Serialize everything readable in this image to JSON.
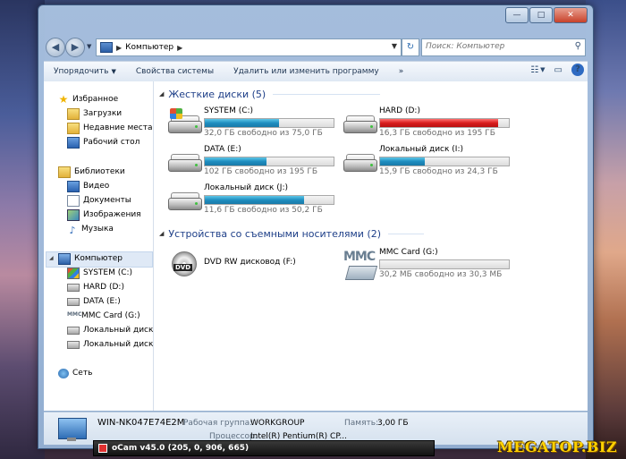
{
  "address": {
    "breadcrumb": "Компьютер",
    "search_placeholder": "Поиск: Компьютер"
  },
  "window_controls": {
    "minimize": "—",
    "maximize": "□",
    "close": "✕"
  },
  "toolbar": {
    "organize": "Упорядочить",
    "system_props": "Свойства системы",
    "uninstall": "Удалить или изменить программу",
    "more": "»",
    "help": "?"
  },
  "nav": {
    "favorites": "Избранное",
    "downloads": "Загрузки",
    "recent": "Недавние места",
    "desktop": "Рабочий стол",
    "libraries": "Библиотеки",
    "video": "Видео",
    "documents": "Документы",
    "images": "Изображения",
    "music": "Музыка",
    "computer": "Компьютер",
    "drive_c": "SYSTEM (C:)",
    "drive_d": "HARD (D:)",
    "drive_e": "DATA (E:)",
    "drive_g": "MMC Card (G:)",
    "drive_i": "Локальный диск (I:)",
    "drive_j": "Локальный диск (J:)",
    "network": "Сеть"
  },
  "groups": {
    "hdd": "Жесткие диски (5)",
    "removable": "Устройства со съемными носителями (2)"
  },
  "drives": [
    {
      "name": "SYSTEM (C:)",
      "free": "32,0 ГБ свободно из 75,0 ГБ",
      "used_fraction": 0.573,
      "status": "normal"
    },
    {
      "name": "HARD (D:)",
      "free": "16,3 ГБ свободно из 195 ГБ",
      "used_fraction": 0.916,
      "status": "full"
    },
    {
      "name": "DATA (E:)",
      "free": "102 ГБ свободно из 195 ГБ",
      "used_fraction": 0.477,
      "status": "normal"
    },
    {
      "name": "Локальный диск (I:)",
      "free": "15,9 ГБ свободно из 24,3 ГБ",
      "used_fraction": 0.346,
      "status": "normal"
    },
    {
      "name": "Локальный диск (J:)",
      "free": "11,6 ГБ свободно из 50,2 ГБ",
      "used_fraction": 0.769,
      "status": "normal"
    }
  ],
  "removable": {
    "dvd": {
      "name": "DVD RW дисковод (F:)",
      "icon_label": "DVD"
    },
    "mmc": {
      "name": "MMC Card (G:)",
      "free": "30,2 МБ свободно из 30,3 МБ",
      "used_fraction": 0.003,
      "logo": "MMC"
    }
  },
  "details": {
    "pc_name": "WIN-NK047E74E2M",
    "workgroup_label": "Рабочая группа:",
    "workgroup": "WORKGROUP",
    "memory_label": "Память:",
    "memory": "3,00 ГБ",
    "cpu_label": "Процессор:",
    "cpu": "Intel(R) Pentium(R) CP..."
  },
  "ocam": {
    "title": "oCam v45.0 (205, 0, 906, 665)"
  },
  "watermark": "MEGATOP.BIZ",
  "colors": {
    "bar_normal": "#1e8dbf",
    "bar_full": "#d81c1c",
    "group_header": "#1e3f88"
  }
}
